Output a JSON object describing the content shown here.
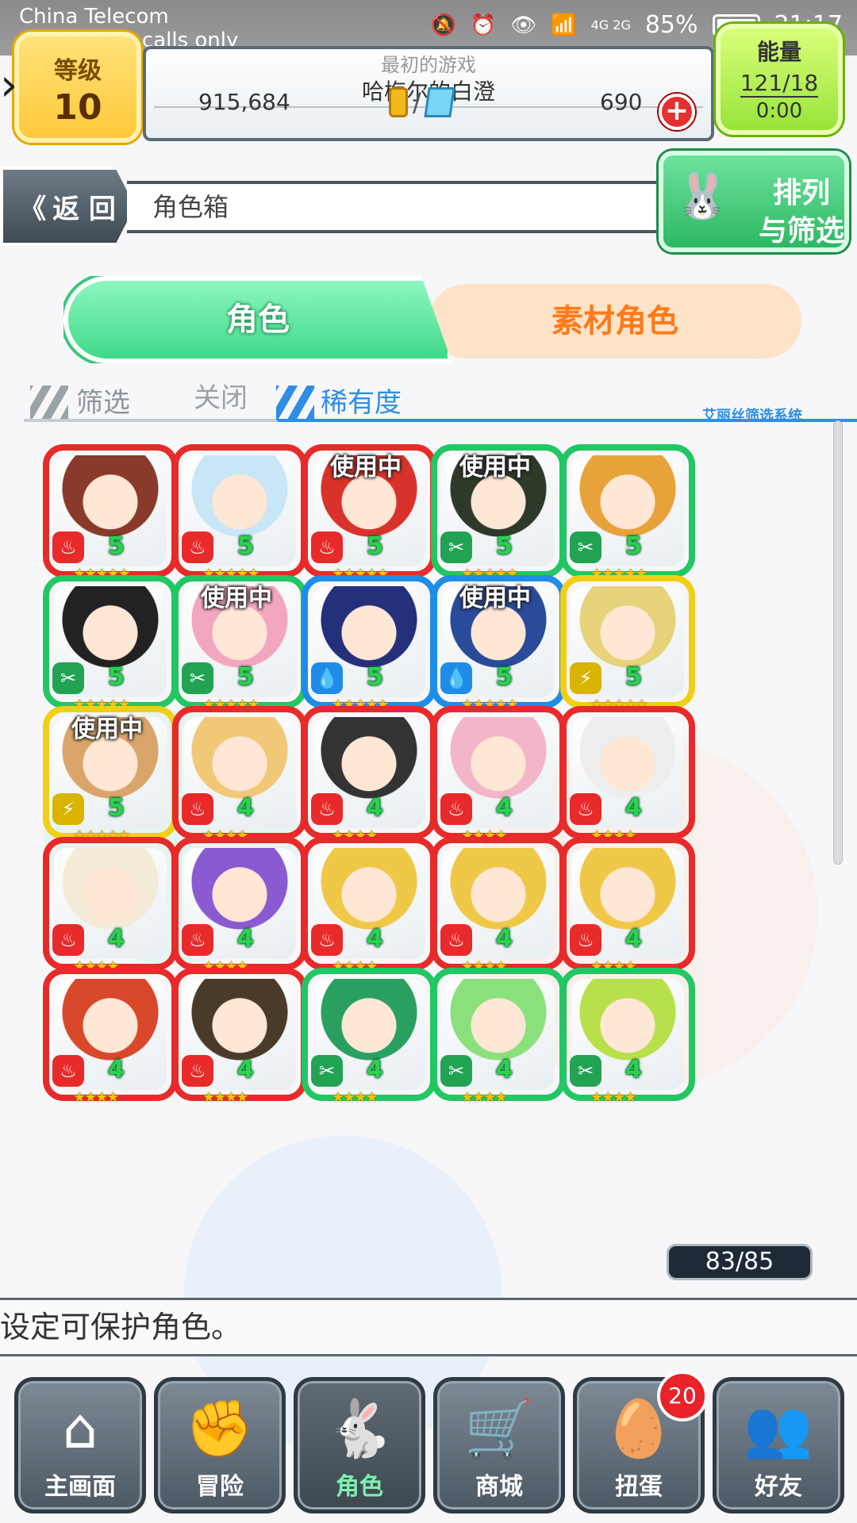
{
  "status_bar": {
    "carrier": "China Telecom",
    "emergency": "Emergency calls only",
    "network": "4G 2G",
    "battery": "85%",
    "time": "21:17"
  },
  "hud": {
    "level_label": "等级",
    "level_value": "10",
    "game_title": "最初的游戏",
    "player_name": "哈梅尔的白澄",
    "coins": "915,684",
    "separator": "/",
    "gems": "690",
    "add_label": "+",
    "energy_label": "能量",
    "energy_value": "121/18",
    "energy_timer": "0:00"
  },
  "header": {
    "back_label": "返 回",
    "page_title": "角色箱",
    "sort_line1": "排列",
    "sort_line2": "与筛选"
  },
  "tabs": {
    "characters": "角色",
    "material": "素材角色"
  },
  "filter": {
    "label": "筛选",
    "state": "关闭",
    "sort_by": "稀有度",
    "system_label": "艾丽丝筛选系统"
  },
  "colors": {
    "fire": "#e82a2a",
    "wood": "#22c763",
    "water": "#1f8de8",
    "thunder": "#f2cf17"
  },
  "characters": [
    {
      "attr": "fire",
      "rarity": "5",
      "in_use": ""
    },
    {
      "attr": "fire",
      "rarity": "5",
      "in_use": ""
    },
    {
      "attr": "fire",
      "rarity": "5",
      "in_use": "使用中"
    },
    {
      "attr": "wood",
      "rarity": "5",
      "in_use": "使用中"
    },
    {
      "attr": "wood",
      "rarity": "5",
      "in_use": ""
    },
    {
      "attr": "wood",
      "rarity": "5",
      "in_use": ""
    },
    {
      "attr": "wood",
      "rarity": "5",
      "in_use": "使用中"
    },
    {
      "attr": "water",
      "rarity": "5",
      "in_use": ""
    },
    {
      "attr": "water",
      "rarity": "5",
      "in_use": "使用中"
    },
    {
      "attr": "thunder",
      "rarity": "5",
      "in_use": ""
    },
    {
      "attr": "thunder",
      "rarity": "5",
      "in_use": "使用中"
    },
    {
      "attr": "fire",
      "rarity": "4",
      "in_use": ""
    },
    {
      "attr": "fire",
      "rarity": "4",
      "in_use": ""
    },
    {
      "attr": "fire",
      "rarity": "4",
      "in_use": ""
    },
    {
      "attr": "fire",
      "rarity": "4",
      "in_use": ""
    },
    {
      "attr": "fire",
      "rarity": "4",
      "in_use": ""
    },
    {
      "attr": "fire",
      "rarity": "4",
      "in_use": ""
    },
    {
      "attr": "fire",
      "rarity": "4",
      "in_use": ""
    },
    {
      "attr": "fire",
      "rarity": "4",
      "in_use": ""
    },
    {
      "attr": "fire",
      "rarity": "4",
      "in_use": ""
    },
    {
      "attr": "fire",
      "rarity": "4",
      "in_use": ""
    },
    {
      "attr": "fire",
      "rarity": "4",
      "in_use": ""
    },
    {
      "attr": "wood",
      "rarity": "4",
      "in_use": ""
    },
    {
      "attr": "wood",
      "rarity": "4",
      "in_use": ""
    },
    {
      "attr": "wood",
      "rarity": "4",
      "in_use": ""
    }
  ],
  "box_count": "83/85",
  "message": "设定可保护角色。",
  "nav": {
    "home": "主画面",
    "adventure": "冒险",
    "characters": "角色",
    "shop": "商城",
    "gacha": "扭蛋",
    "friends": "好友",
    "gacha_badge": "20"
  }
}
